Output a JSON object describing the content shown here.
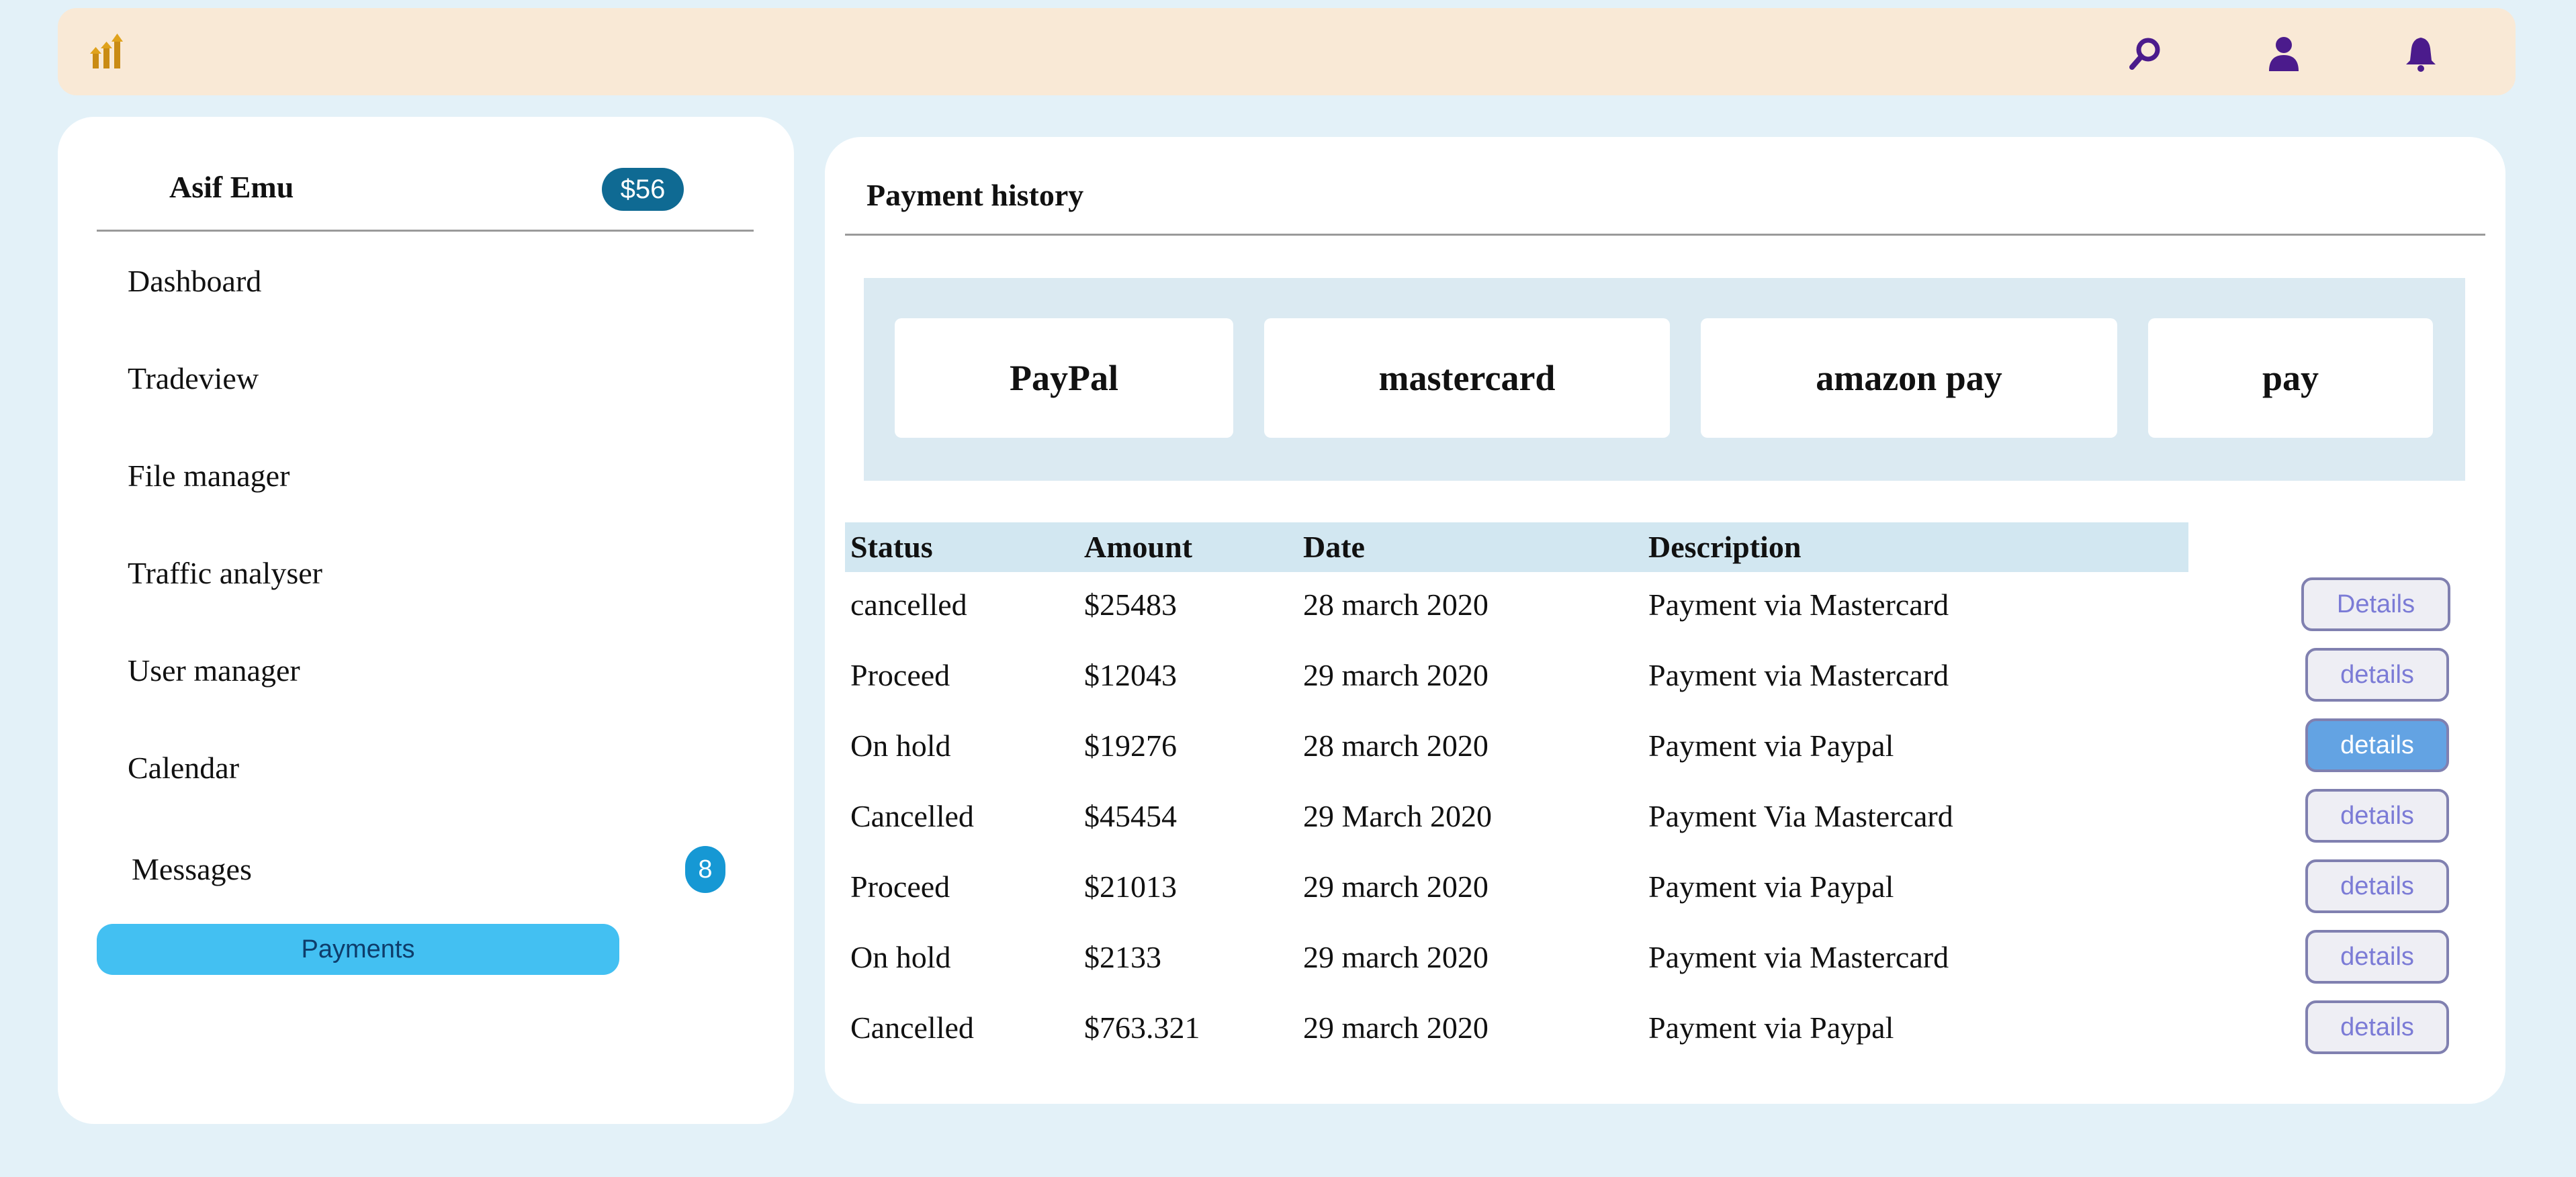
{
  "header": {
    "logo_icon": "bar-chart-growth-icon",
    "icons": [
      "search-icon",
      "user-icon",
      "bell-icon"
    ],
    "icon_color": "#4b1b8c"
  },
  "sidebar": {
    "user_name": "Asif Emu",
    "balance": "$56",
    "items": [
      {
        "label": "Dashboard"
      },
      {
        "label": "Tradeview"
      },
      {
        "label": "File manager"
      },
      {
        "label": "Traffic analyser"
      },
      {
        "label": "User manager"
      },
      {
        "label": "Calendar"
      },
      {
        "label": "Messages",
        "badge": "8"
      }
    ],
    "active_button": "Payments"
  },
  "main": {
    "title": "Payment history",
    "methods": [
      "PayPal",
      "mastercard",
      "amazon pay",
      "pay"
    ],
    "table": {
      "headers": [
        "Status",
        "Amount",
        "Date",
        "Description"
      ],
      "rows": [
        {
          "status": "cancelled",
          "amount": "$25483",
          "date": "28 march 2020",
          "description": "Payment via Mastercard",
          "action": "Details"
        },
        {
          "status": "Proceed",
          "amount": "$12043",
          "date": "29 march 2020",
          "description": "Payment via Mastercard",
          "action": "details"
        },
        {
          "status": "On hold",
          "amount": "$19276",
          "date": "28 march 2020",
          "description": "Payment via Paypal",
          "action": "details"
        },
        {
          "status": "Cancelled",
          "amount": "$45454",
          "date": "29 March 2020",
          "description": "Payment Via Mastercard",
          "action": "details"
        },
        {
          "status": "Proceed",
          "amount": "$21013",
          "date": "29 march 2020",
          "description": "Payment via Paypal",
          "action": "details"
        },
        {
          "status": "On hold",
          "amount": "$2133",
          "date": "29 march 2020",
          "description": "Payment via Mastercard",
          "action": "details"
        },
        {
          "status": "Cancelled",
          "amount": "$763.321",
          "date": "29 march 2020",
          "description": "Payment via Paypal",
          "action": "details"
        }
      ]
    }
  },
  "colors": {
    "page_bg": "#e3f1f8",
    "topbar_bg": "#f9e9d6",
    "balance_badge": "#0f6a93",
    "payments_button": "#43c0f2",
    "active_details": "#63a3e3"
  }
}
